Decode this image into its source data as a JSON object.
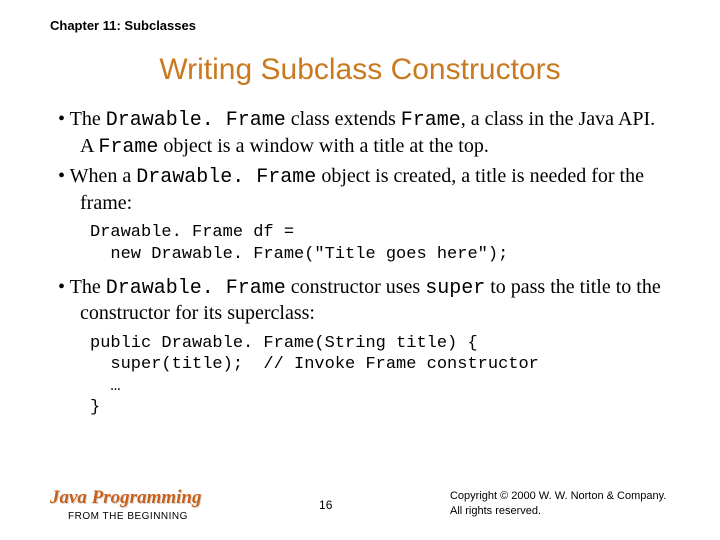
{
  "chapter": "Chapter 11: Subclasses",
  "title": "Writing Subclass Constructors",
  "bullets": [
    {
      "pre": "The ",
      "c1": "Drawable. Frame",
      "mid1": " class extends ",
      "c2": "Frame",
      "mid2": ", a class in the Java API. A ",
      "c3": "Frame",
      "post": " object is a window with a title at the top."
    },
    {
      "pre": "When a ",
      "c1": "Drawable. Frame",
      "post": " object is created, a title is needed for the frame:"
    }
  ],
  "code1": "Drawable. Frame df =\n  new Drawable. Frame(\"Title goes here\");",
  "bullet3": {
    "pre": "The ",
    "c1": "Drawable. Frame",
    "mid1": " constructor uses ",
    "c2": "super",
    "post": " to pass the title to the constructor for its superclass:"
  },
  "code2": "public Drawable. Frame(String title) {\n  super(title);  // Invoke Frame constructor\n  …\n}",
  "footer": {
    "brand_title": "Java Programming",
    "brand_sub": "FROM THE BEGINNING",
    "page": "16",
    "copy1": "Copyright © 2000 W. W. Norton & Company.",
    "copy2": "All rights reserved."
  }
}
